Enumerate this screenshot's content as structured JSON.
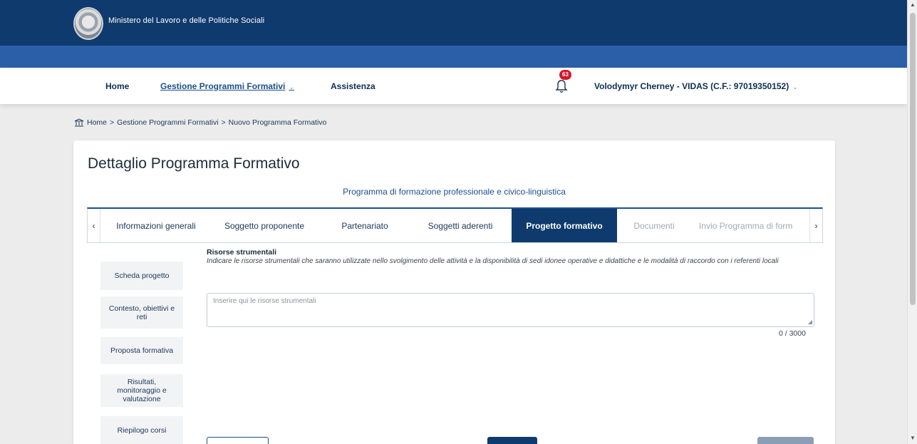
{
  "header": {
    "ministry": "Ministero del Lavoro e delle Politiche Sociali"
  },
  "nav": {
    "home": "Home",
    "gestione": "Gestione Programmi Formativi",
    "assistenza": "Assistenza",
    "notification_count": "63",
    "user": "Volodymyr Cherney - VIDAS (C.F.: 97019350152)"
  },
  "breadcrumb": {
    "home": "Home",
    "sep": ">",
    "gestione": "Gestione Programmi Formativi",
    "current": "Nuovo Programma Formativo"
  },
  "page": {
    "title": "Dettaglio Programma Formativo",
    "subtitle": "Programma di formazione professionale e civico-linguistica"
  },
  "tabs": [
    {
      "label": "Informazioni generali",
      "state": "normal"
    },
    {
      "label": "Soggetto proponente",
      "state": "normal"
    },
    {
      "label": "Partenariato",
      "state": "normal"
    },
    {
      "label": "Soggetti aderenti",
      "state": "normal"
    },
    {
      "label": "Progetto formativo",
      "state": "active"
    },
    {
      "label": "Documenti",
      "state": "disabled"
    },
    {
      "label": "Invio Programma di form",
      "state": "disabled"
    }
  ],
  "side_nav": [
    {
      "label": "Scheda progetto"
    },
    {
      "label": "Contesto, obiettivi e reti"
    },
    {
      "label": "Proposta formativa"
    },
    {
      "label": "Risultati, monitoraggio e valutazione"
    },
    {
      "label": "Riepilogo corsi"
    }
  ],
  "form": {
    "label": "Risorse strumentali",
    "help": "Indicare le risorse strumentali che saranno utilizzate nello svolgimento delle attività e la disponibilità di sedi idonee operative e didattiche e le modalità di raccordo con i referenti locali",
    "placeholder": "Inserire qui le risorse strumentali",
    "counter": "0 / 3000"
  },
  "colors": {
    "primary_dark": "#0f3a6e",
    "primary": "#2b5fa8",
    "badge": "#d4182a"
  }
}
